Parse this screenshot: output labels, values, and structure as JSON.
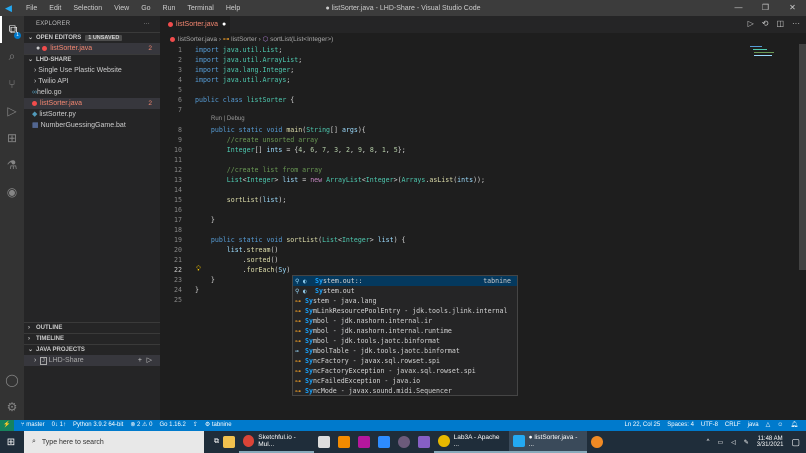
{
  "title_bar": {
    "menu": [
      "File",
      "Edit",
      "Selection",
      "View",
      "Go",
      "Run",
      "Terminal",
      "Help"
    ],
    "window_title": "● listSorter.java - LHD-Share - Visual Studio Code",
    "controls": [
      "—",
      "❐",
      "✕"
    ]
  },
  "activity_bar": {
    "explorer_badge": "1"
  },
  "sidebar": {
    "header": "EXPLORER",
    "more": "···",
    "open_editors": {
      "label": "OPEN EDITORS",
      "badge": "1 UNSAVED",
      "items": [
        {
          "name": "listSorter.java",
          "count": "2"
        }
      ]
    },
    "workspace": {
      "label": "LHD-SHARE",
      "items": [
        {
          "name": "Single Use Plastic Website",
          "type": "folder"
        },
        {
          "name": "Twilio API",
          "type": "folder"
        },
        {
          "name": "hello.go",
          "type": "go"
        },
        {
          "name": "listSorter.java",
          "type": "java-error",
          "count": "2"
        },
        {
          "name": "listSorter.py",
          "type": "py"
        },
        {
          "name": "NumberGuessingGame.bat",
          "type": "bat"
        }
      ]
    },
    "outline": "OUTLINE",
    "timeline": "TIMELINE",
    "java_projects": "JAVA PROJECTS",
    "project": "LHD-Share"
  },
  "editor": {
    "tab": "listSorter.java",
    "breadcrumb": [
      "listSorter.java",
      "listSorter",
      "sortList(List<Integer>)"
    ],
    "codelens": "Run | Debug",
    "lines": [
      [
        [
          "import ",
          "kw"
        ],
        [
          "java.util.List",
          "ty"
        ],
        [
          ";",
          "pl"
        ]
      ],
      [
        [
          "import ",
          "kw"
        ],
        [
          "java.util.ArrayList",
          "ty"
        ],
        [
          ";",
          "pl"
        ]
      ],
      [
        [
          "import ",
          "kw"
        ],
        [
          "java.lang.Integer",
          "ty"
        ],
        [
          ";",
          "pl"
        ]
      ],
      [
        [
          "import ",
          "kw"
        ],
        [
          "java.util.Arrays",
          "ty"
        ],
        [
          ";",
          "pl"
        ]
      ],
      [],
      [
        [
          "public class ",
          "kw"
        ],
        [
          "listSorter",
          "ty"
        ],
        [
          " {",
          "pl"
        ]
      ],
      [],
      [
        [
          "    public static void ",
          "kw"
        ],
        [
          "main",
          "fn"
        ],
        [
          "(",
          "pl"
        ],
        [
          "String",
          "ty"
        ],
        [
          "[] ",
          "pl"
        ],
        [
          "args",
          "va"
        ],
        [
          "){",
          "pl"
        ]
      ],
      [
        [
          "        //create unsorted array",
          "cm"
        ]
      ],
      [
        [
          "        Integer",
          "ty"
        ],
        [
          "[] ",
          "pl"
        ],
        [
          "ints",
          "va"
        ],
        [
          " = {",
          "pl"
        ],
        [
          "4",
          "nu"
        ],
        [
          ", ",
          "pl"
        ],
        [
          "6",
          "nu"
        ],
        [
          ", ",
          "pl"
        ],
        [
          "7",
          "nu"
        ],
        [
          ", ",
          "pl"
        ],
        [
          "3",
          "nu"
        ],
        [
          ", ",
          "pl"
        ],
        [
          "2",
          "nu"
        ],
        [
          ", ",
          "pl"
        ],
        [
          "9",
          "nu"
        ],
        [
          ", ",
          "pl"
        ],
        [
          "8",
          "nu"
        ],
        [
          ", ",
          "pl"
        ],
        [
          "1",
          "nu"
        ],
        [
          ", ",
          "pl"
        ],
        [
          "5",
          "nu"
        ],
        [
          "};",
          "pl"
        ]
      ],
      [],
      [
        [
          "        //create list from array",
          "cm"
        ]
      ],
      [
        [
          "        List",
          "ty"
        ],
        [
          "<",
          "pl"
        ],
        [
          "Integer",
          "ty"
        ],
        [
          "> ",
          "pl"
        ],
        [
          "list",
          "va"
        ],
        [
          " = ",
          "pl"
        ],
        [
          "new ",
          "ne"
        ],
        [
          "ArrayList",
          "ty"
        ],
        [
          "<",
          "pl"
        ],
        [
          "Integer",
          "ty"
        ],
        [
          ">(",
          "pl"
        ],
        [
          "Arrays",
          "ty"
        ],
        [
          ".",
          "pl"
        ],
        [
          "asList",
          "fn"
        ],
        [
          "(",
          "pl"
        ],
        [
          "ints",
          "va"
        ],
        [
          "));",
          "pl"
        ]
      ],
      [],
      [
        [
          "        sortList",
          "fn"
        ],
        [
          "(",
          "pl"
        ],
        [
          "list",
          "va"
        ],
        [
          ");",
          "pl"
        ]
      ],
      [],
      [
        [
          "    }",
          "pl"
        ]
      ],
      [],
      [
        [
          "    public static void ",
          "kw"
        ],
        [
          "sortList",
          "fn"
        ],
        [
          "(",
          "pl"
        ],
        [
          "List",
          "ty"
        ],
        [
          "<",
          "pl"
        ],
        [
          "Integer",
          "ty"
        ],
        [
          "> ",
          "pl"
        ],
        [
          "list",
          "va"
        ],
        [
          ") {",
          "pl"
        ]
      ],
      [
        [
          "        list",
          "va"
        ],
        [
          ".",
          "pl"
        ],
        [
          "stream",
          "fn"
        ],
        [
          "()",
          "pl"
        ]
      ],
      [
        [
          "            .",
          "pl"
        ],
        [
          "sorted",
          "fn"
        ],
        [
          "()",
          "pl"
        ]
      ],
      [
        [
          "            .",
          "pl"
        ],
        [
          "forEach",
          "fn"
        ],
        [
          "(",
          "pl"
        ],
        [
          "Sy",
          "va"
        ],
        [
          ")",
          "pl"
        ]
      ],
      [
        [
          "    }",
          "pl"
        ]
      ],
      [
        [
          "}",
          "pl"
        ]
      ],
      []
    ]
  },
  "suggestions": [
    {
      "match": "Sy",
      "rest": "stem.out::",
      "detail": "",
      "source": "tabnine",
      "icon": "wrench"
    },
    {
      "match": "Sy",
      "rest": "stem.out",
      "detail": "",
      "source": "",
      "icon": "wrench"
    },
    {
      "match": "Sy",
      "rest": "stem",
      "detail": " - java.lang",
      "icon": "class"
    },
    {
      "match": "Sy",
      "rest": "mLinkResourcePoolEntry",
      "detail": " - jdk.tools.jlink.internal",
      "icon": "class"
    },
    {
      "match": "Sy",
      "rest": "mbol",
      "detail": " - jdk.nashorn.internal.ir",
      "icon": "class"
    },
    {
      "match": "Sy",
      "rest": "mbol",
      "detail": " - jdk.nashorn.internal.runtime",
      "icon": "class"
    },
    {
      "match": "Sy",
      "rest": "mbol",
      "detail": " - jdk.tools.jaotc.binformat",
      "icon": "class"
    },
    {
      "match": "Sy",
      "rest": "mbolTable",
      "detail": " - jdk.tools.jaotc.binformat",
      "icon": "interface"
    },
    {
      "match": "Sy",
      "rest": "ncFactory",
      "detail": " - javax.sql.rowset.spi",
      "icon": "class"
    },
    {
      "match": "Sy",
      "rest": "ncFactoryException",
      "detail": " - javax.sql.rowset.spi",
      "icon": "class"
    },
    {
      "match": "Sy",
      "rest": "ncFailedException",
      "detail": " - java.io",
      "icon": "class"
    },
    {
      "match": "Sy",
      "rest": "ncMode",
      "detail": " - javax.sound.midi.Sequencer",
      "icon": "class"
    }
  ],
  "status_bar": {
    "branch": "master",
    "sync": "0↓ 1↑",
    "python": "Python 3.9.2 64-bit",
    "problems": "⊗ 2 ⚠ 0",
    "go": "Go 1.16.2",
    "tabnine": "tabnine",
    "position": "Ln 22, Col 25",
    "spaces": "Spaces: 4",
    "encoding": "UTF-8",
    "eol": "CRLF",
    "language": "java"
  },
  "taskbar": {
    "search_placeholder": "Type here to search",
    "apps": [
      "Sketchful.io - Mul...",
      "Lab3A - Apache ...",
      "● listSorter.java - ..."
    ],
    "time": "11:48 AM",
    "date": "3/31/2021"
  }
}
